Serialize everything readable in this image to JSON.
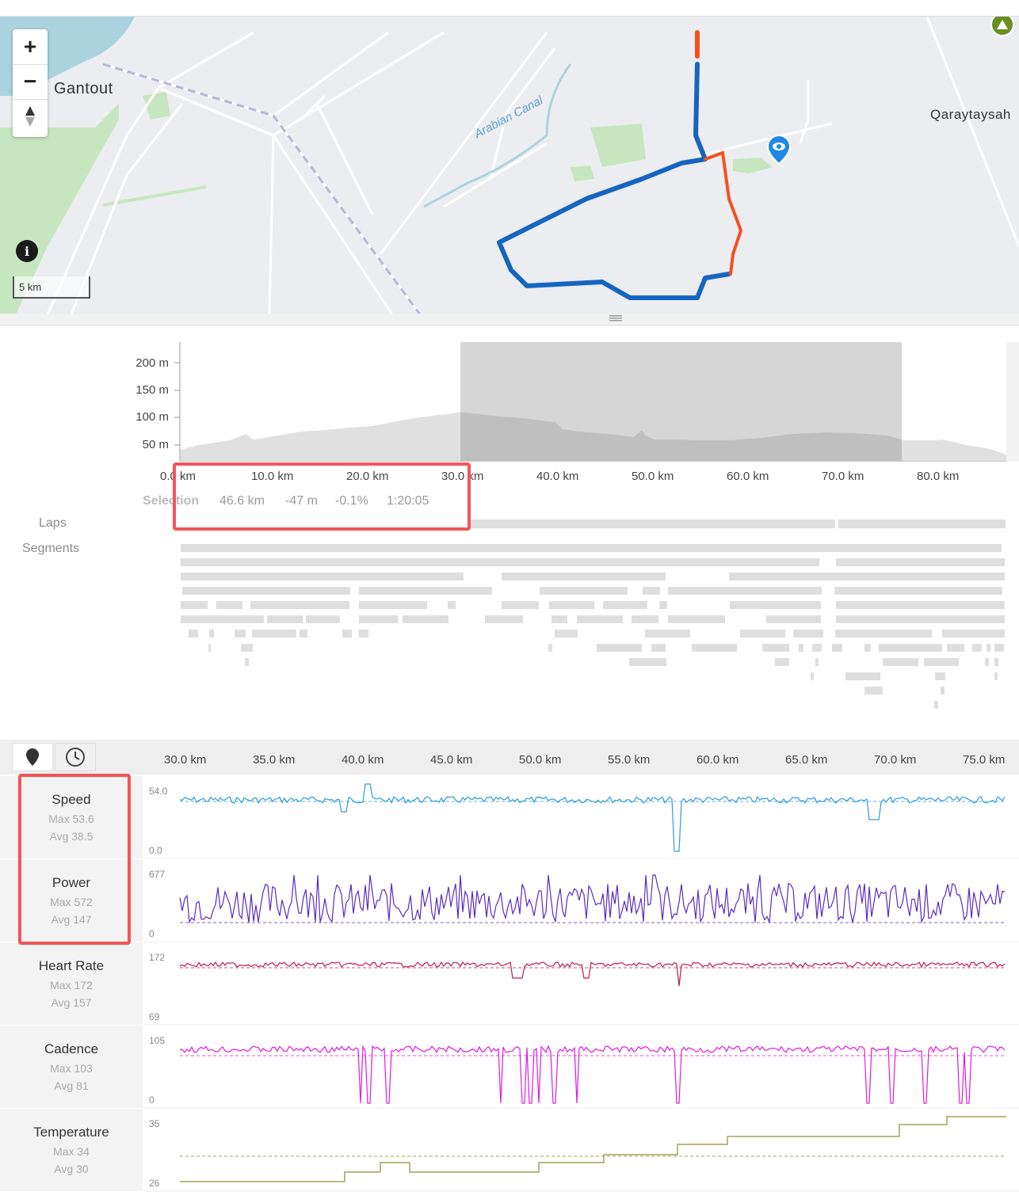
{
  "map": {
    "place_labels": {
      "left": "Gantout",
      "right": "Qaraytaysah",
      "canal": "Arabian Canal"
    },
    "controls": {
      "zoom_in": "+",
      "zoom_out": "−",
      "info": "i"
    },
    "scale": "5 km",
    "colors": {
      "route_blue": "#1565c0",
      "route_orange": "#f4511e",
      "water": "#aad3df",
      "park": "#c6e6c0"
    }
  },
  "elevation": {
    "y_ticks": [
      "200 m",
      "150 m",
      "100 m",
      "50 m"
    ],
    "x_ticks": [
      "0.0 km",
      "10.0 km",
      "20.0 km",
      "30.0 km",
      "40.0 km",
      "50.0 km",
      "60.0 km",
      "70.0 km",
      "80.0 km"
    ],
    "selection": {
      "label": "Selection",
      "distance": "46.6 km",
      "elev_change": "-47 m",
      "grade": "-0.1%",
      "time": "1:20:05"
    },
    "laps_label": "Laps",
    "segments_label": "Segments"
  },
  "streams": {
    "x_ticks": [
      "30.0 km",
      "35.0 km",
      "40.0 km",
      "45.0 km",
      "50.0 km",
      "55.0 km",
      "60.0 km",
      "65.0 km",
      "70.0 km",
      "75.0 km"
    ],
    "icons": {
      "distance": "map-pin-icon",
      "time": "clock-icon"
    },
    "items": [
      {
        "title": "Speed",
        "max": "Max 53.6",
        "avg": "Avg 38.5",
        "ymax": "54.0",
        "ymin": "0.0",
        "color": "#2d9ad6"
      },
      {
        "title": "Power",
        "max": "Max 572",
        "avg": "Avg 147",
        "ymax": "677",
        "ymin": "0",
        "color": "#5b2bc2"
      },
      {
        "title": "Heart Rate",
        "max": "Max 172",
        "avg": "Avg 157",
        "ymax": "172",
        "ymin": "69",
        "color": "#c2184a"
      },
      {
        "title": "Cadence",
        "max": "Max 103",
        "avg": "Avg 81",
        "ymax": "105",
        "ymin": "0",
        "color": "#e01ae0"
      },
      {
        "title": "Temperature",
        "max": "Max 34",
        "avg": "Avg 30",
        "ymax": "35",
        "ymin": "26",
        "color": "#a3a35a"
      }
    ]
  }
}
